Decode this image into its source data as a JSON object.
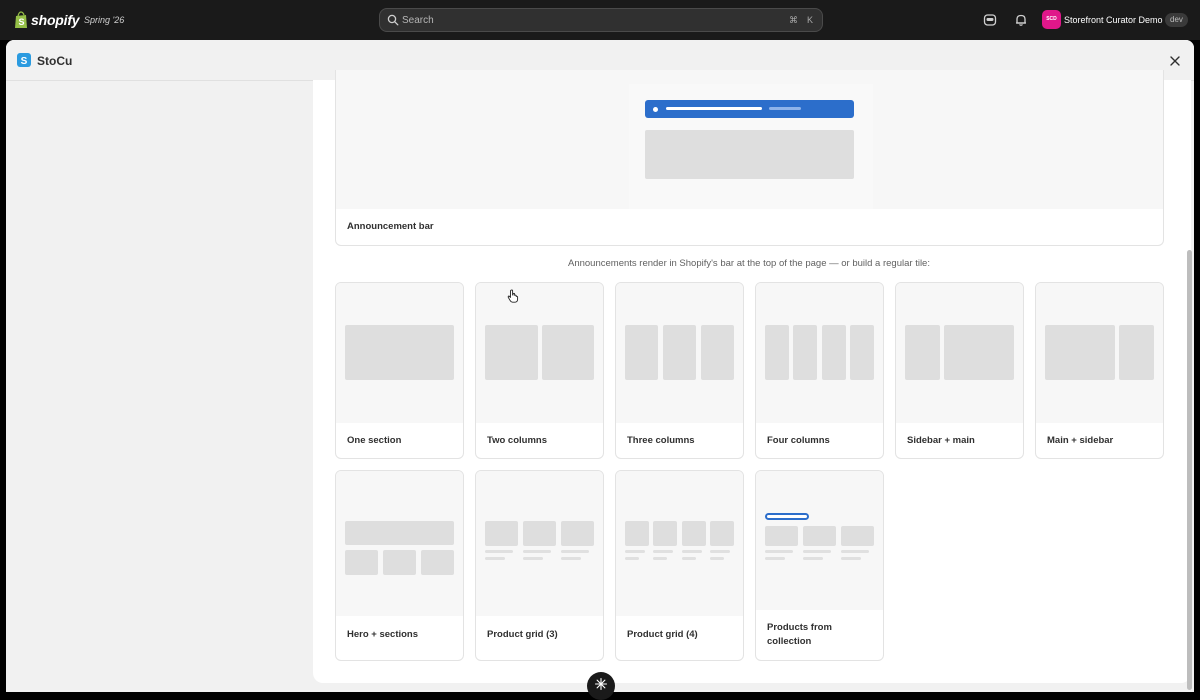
{
  "topbar": {
    "logo_text": "shopify",
    "edition": "Spring '26",
    "search_placeholder": "Search",
    "shortcut_cmd": "⌘",
    "shortcut_key": "K",
    "avatar_initials": "SCD",
    "store_name": "Storefront Curator Demo",
    "store_badge": "dev"
  },
  "app": {
    "title": "StoCu"
  },
  "announcement": {
    "label": "Announcement bar"
  },
  "hint_text": "Announcements render in Shopify's bar at the top of the page — or build a regular tile:",
  "layouts": [
    {
      "label": "One section"
    },
    {
      "label": "Two columns"
    },
    {
      "label": "Three columns"
    },
    {
      "label": "Four columns"
    },
    {
      "label": "Sidebar + main"
    },
    {
      "label": "Main + sidebar"
    },
    {
      "label": "Hero + sections"
    },
    {
      "label": "Product grid (3)"
    },
    {
      "label": "Product grid (4)"
    },
    {
      "label": "Products from collection"
    }
  ],
  "colors": {
    "accent_blue": "#2c6ecb",
    "avatar_pink": "#e0178a",
    "topbar": "#1a1a1a"
  }
}
